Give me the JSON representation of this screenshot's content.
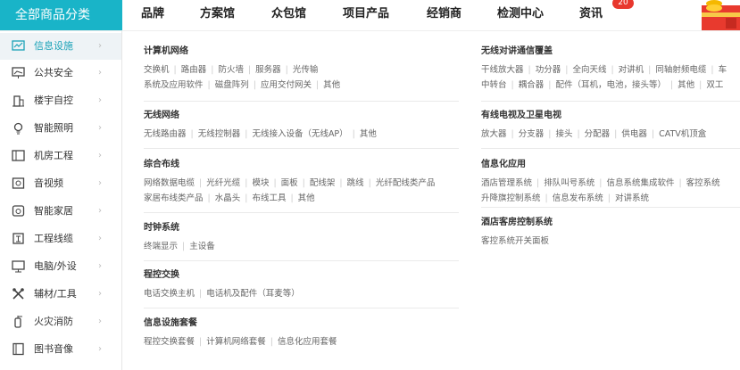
{
  "header": {
    "category_label": "全部商品分类",
    "nav": [
      {
        "label": "品牌"
      },
      {
        "label": "方案馆"
      },
      {
        "label": "众包馆"
      },
      {
        "label": "项目产品"
      },
      {
        "label": "经销商"
      },
      {
        "label": "检测中心"
      },
      {
        "label": "资讯",
        "badge": "20"
      }
    ],
    "badge_color": "#e8372d",
    "accent": "#19b4c8"
  },
  "sidebar": {
    "items": [
      {
        "label": "信息设施",
        "icon": "chart-screen-icon",
        "active": true
      },
      {
        "label": "公共安全",
        "icon": "monitor-chart-icon"
      },
      {
        "label": "楼宇自控",
        "icon": "building-icon"
      },
      {
        "label": "智能照明",
        "icon": "bulb-icon"
      },
      {
        "label": "机房工程",
        "icon": "server-room-icon"
      },
      {
        "label": "音视频",
        "icon": "video-icon"
      },
      {
        "label": "智能家居",
        "icon": "smart-home-icon"
      },
      {
        "label": "工程线缆",
        "icon": "cable-icon"
      },
      {
        "label": "电脑/外设",
        "icon": "computer-icon"
      },
      {
        "label": "辅材/工具",
        "icon": "tools-icon"
      },
      {
        "label": "火灾消防",
        "icon": "fire-extinguisher-icon"
      },
      {
        "label": "图书音像",
        "icon": "book-icon"
      }
    ],
    "arrow": "›"
  },
  "left_sections": [
    {
      "title": "计算机网络",
      "lines": [
        [
          "交换机",
          "路由器",
          "防火墙",
          "服务器",
          "光传输"
        ],
        [
          "系统及应用软件",
          "磁盘阵列",
          "应用交付网关",
          "其他"
        ]
      ]
    },
    {
      "title": "无线网络",
      "lines": [
        [
          "无线路由器",
          "无线控制器",
          "无线接入设备（无线AP）",
          "其他"
        ]
      ]
    },
    {
      "title": "综合布线",
      "lines": [
        [
          "网络数据电缆",
          "光纤光缆",
          "模块",
          "面板",
          "配线架",
          "跳线",
          "光纤配线类产品"
        ],
        [
          "家居布线类产品",
          "水晶头",
          "布线工具",
          "其他"
        ]
      ]
    },
    {
      "title": "时钟系统",
      "lines": [
        [
          "终端显示",
          "主设备"
        ]
      ]
    },
    {
      "title": "程控交换",
      "lines": [
        [
          "电话交换主机",
          "电话机及配件（耳麦等）"
        ]
      ]
    },
    {
      "title": "信息设施套餐",
      "lines": [
        [
          "程控交换套餐",
          "计算机网络套餐",
          "信息化应用套餐"
        ]
      ]
    }
  ],
  "right_sections": [
    {
      "title": "无线对讲通信覆盖",
      "lines": [
        [
          "干线放大器",
          "功分器",
          "全向天线",
          "对讲机",
          "同轴射频电缆",
          "车"
        ],
        [
          "中转台",
          "耦合器",
          "配件（耳机，电池，接头等）",
          "其他",
          "双工"
        ]
      ]
    },
    {
      "title": "有线电视及卫星电视",
      "lines": [
        [
          "放大器",
          "分支器",
          "接头",
          "分配器",
          "供电器",
          "CATV机顶盒"
        ]
      ]
    },
    {
      "title": "信息化应用",
      "lines": [
        [
          "酒店管理系统",
          "排队叫号系统",
          "信息系统集成软件",
          "客控系统"
        ],
        [
          "升降旗控制系统",
          "信息发布系统",
          "对讲系统"
        ]
      ]
    },
    {
      "title": "酒店客房控制系统",
      "lines": [
        [
          "客控系统开关面板"
        ]
      ]
    }
  ]
}
